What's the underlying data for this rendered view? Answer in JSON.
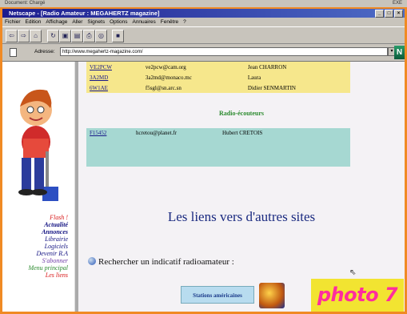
{
  "prev_window": {
    "left_text": "Document: Chargé",
    "right_text": "EXE"
  },
  "window": {
    "title": "Netscape - [Radio Amateur : MEGAHERTZ magazine]"
  },
  "menu": [
    "Fichier",
    "Edition",
    "Affichage",
    "Aller",
    "Signets",
    "Options",
    "Annuaires",
    "Fenêtre",
    "?"
  ],
  "toolbar": {
    "icons": [
      "back-icon",
      "forward-icon",
      "home-icon",
      "reload-icon",
      "images-icon",
      "open-icon",
      "print-icon",
      "find-icon",
      "stop-icon"
    ]
  },
  "address": {
    "label": "Adresse:",
    "value": "http://www.megahertz-magazine.com/"
  },
  "nav": [
    {
      "label": "Flash !",
      "color": "#d81818"
    },
    {
      "label": "Actualité",
      "color": "#101080"
    },
    {
      "label": "Annonces",
      "color": "#101080"
    },
    {
      "label": "Librairie",
      "color": "#101080"
    },
    {
      "label": "Logiciels",
      "color": "#101080"
    },
    {
      "label": "Devenir R.A",
      "color": "#101080"
    },
    {
      "label": "S'abonner",
      "color": "#6e3aa6"
    },
    {
      "label": "Menu principal",
      "color": "#2b8a2e"
    },
    {
      "label": "Les liens",
      "color": "#d81818"
    }
  ],
  "amateurs": [
    {
      "call": "VE2PCW",
      "email": "ve2pcw@cam.org",
      "name": "Jean CHARRON"
    },
    {
      "call": "3A2MD",
      "email": "3a2md@monaco.mc",
      "name": "Laura"
    },
    {
      "call": "6W1AE",
      "email": "f5sgl@sn.arc.sn",
      "name": "Didier SENMARTIN"
    }
  ],
  "listeners_title": "Radio-écouteurs",
  "listeners": [
    {
      "call": "F15452",
      "email": "hcretou@planet.fr",
      "name": "Hubert CRETOIS"
    }
  ],
  "links_title": "Les liens vers d'autres sites",
  "search_label": "Rechercher un indicatif radioamateur :",
  "stations_label": "Stations américaines",
  "photo_label": "photo 7"
}
